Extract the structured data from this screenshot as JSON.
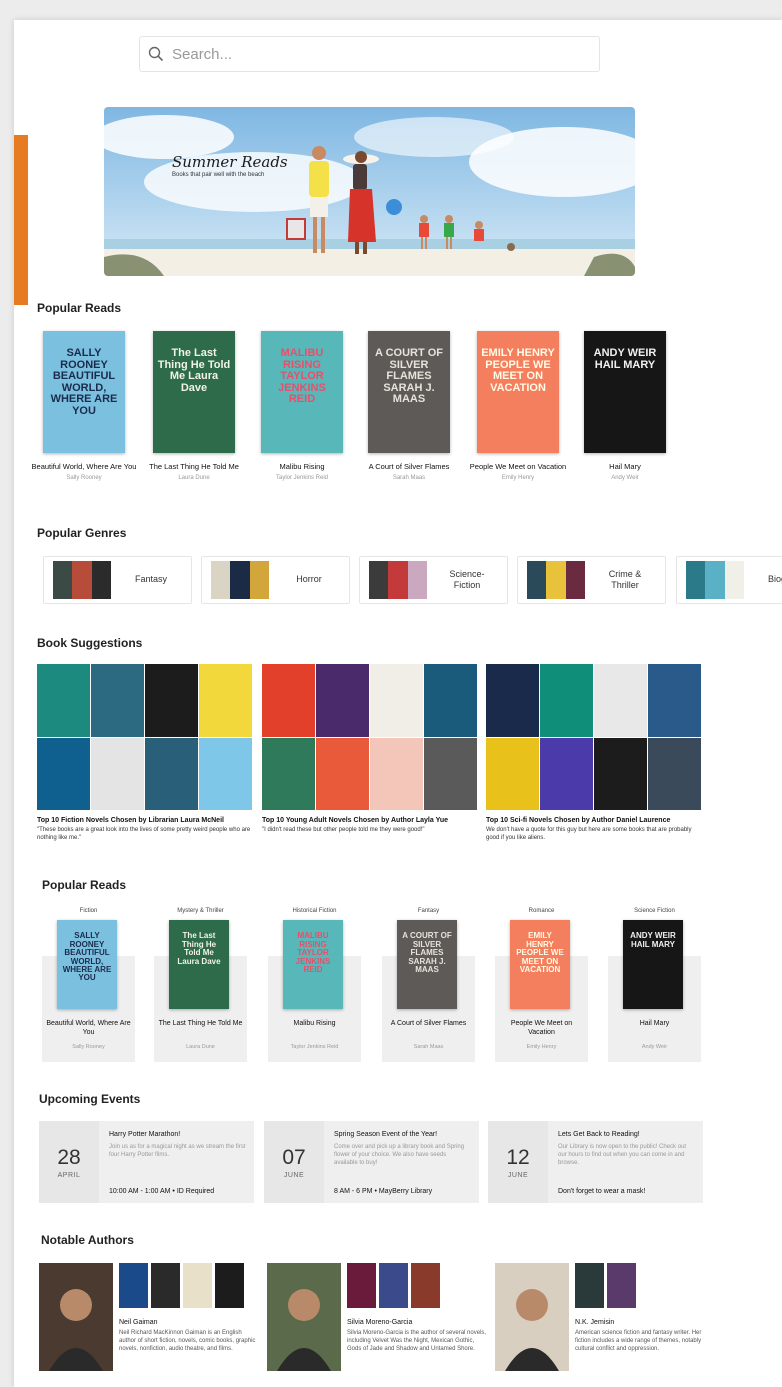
{
  "search": {
    "placeholder": "Search..."
  },
  "hero": {
    "title": "Summer Reads",
    "subtitle": "Books that pair well with the beach"
  },
  "sections": {
    "popular_reads": "Popular Reads",
    "popular_genres": "Popular Genres",
    "book_suggestions": "Book Suggestions",
    "popular_reads_2": "Popular Reads",
    "upcoming_events": "Upcoming Events",
    "notable_authors": "Notable Authors"
  },
  "books": [
    {
      "title": "Beautiful World, Where Are You",
      "author": "Sally Rooney",
      "cover_text": "SALLY ROONEY BEAUTIFUL WORLD, WHERE ARE YOU",
      "bg": "#7cc0e0",
      "fg": "#1a2c4c"
    },
    {
      "title": "The Last Thing He Told Me",
      "author": "Laura Dune",
      "cover_text": "The Last Thing He Told Me Laura Dave",
      "bg": "#2e6b4a",
      "fg": "#f2f2e8"
    },
    {
      "title": "Malibu Rising",
      "author": "Taylor Jenkins Reid",
      "cover_text": "MALIBU RISING TAYLOR JENKINS REID",
      "bg": "#58b8b9",
      "fg": "#e84f6a"
    },
    {
      "title": "A Court of Silver Flames",
      "author": "Sarah Maas",
      "cover_text": "A COURT OF SILVER FLAMES SARAH J. MAAS",
      "bg": "#5e5a58",
      "fg": "#e8e2da"
    },
    {
      "title": "People We Meet on Vacation",
      "author": "Emily Henry",
      "cover_text": "EMILY HENRY PEOPLE WE MEET ON VACATION",
      "bg": "#f47f5e",
      "fg": "#fffbe6"
    },
    {
      "title": "Hail Mary",
      "author": "Andy Weir",
      "cover_text": "ANDY WEIR HAIL MARY",
      "bg": "#161616",
      "fg": "#f0f0f0"
    }
  ],
  "genres": [
    {
      "label": "Fantasy",
      "colors": [
        "#3c4a45",
        "#b84c3a",
        "#2b2b2b"
      ]
    },
    {
      "label": "Horror",
      "colors": [
        "#d9d4c4",
        "#1c2b45",
        "#d2a63a"
      ]
    },
    {
      "label": "Science-\nFiction",
      "colors": [
        "#3b3b3b",
        "#c43a3a",
        "#c9a8c0"
      ]
    },
    {
      "label": "Crime &\nThriller",
      "colors": [
        "#2a4a5a",
        "#e8c23a",
        "#6a2a40"
      ]
    },
    {
      "label": "Biog",
      "colors": [
        "#2a7a8a",
        "#5ab0c4",
        "#f0efe8"
      ]
    }
  ],
  "suggestions": [
    {
      "title": "Top 10 Fiction Novels Chosen by Librarian Laura McNeil",
      "quote": "\"These books are a great look into the lives of some pretty weird people who are nothing like me.\"",
      "colors": [
        "#1d8a80",
        "#2b6a80",
        "#1c1c1c",
        "#f2d83a",
        "#0f5f8f",
        "#e4e4e4",
        "#2a5f7a",
        "#7fc7e8"
      ]
    },
    {
      "title": "Top 10 Young Adult Novels Chosen by Author Layla Yue",
      "quote": "\"I didn't read these but other people told me they were good!\"",
      "colors": [
        "#e2402a",
        "#4a2a6a",
        "#f0eee6",
        "#1a5a7a",
        "#2e7a5a",
        "#e85a3a",
        "#f4c6ba",
        "#5a5a5a"
      ]
    },
    {
      "title": "Top 10 Sci-fi Novels Chosen by Author Daniel Laurence",
      "quote": "We don't have a quote for this guy but here are some books that are probably good if you like aliens.",
      "colors": [
        "#1a2a4a",
        "#0f8f7a",
        "#e8e8e8",
        "#2a5a8a",
        "#e8c21a",
        "#4a3aaa",
        "#1c1c1c",
        "#3a4a5a"
      ]
    }
  ],
  "popular_reads_2": [
    {
      "genre": "Fiction",
      "book": 0
    },
    {
      "genre": "Mystery & Thriller",
      "book": 1
    },
    {
      "genre": "Historical Fiction",
      "book": 2
    },
    {
      "genre": "Fantasy",
      "book": 3
    },
    {
      "genre": "Romance",
      "book": 4
    },
    {
      "genre": "Science Fiction",
      "book": 5
    }
  ],
  "events": [
    {
      "day": "28",
      "month": "APRIL",
      "title": "Harry Potter Marathon!",
      "desc": "Join us as for a magical night as we stream the first four Harry Potter films.",
      "meta": "10:00 AM - 1:00 AM • ID Required"
    },
    {
      "day": "07",
      "month": "JUNE",
      "title": "Spring Season Event of the Year!",
      "desc": "Come over and pick up a library book and Spring flower of your choice. We also have seeds available to buy!",
      "meta": "8 AM - 6 PM • MayBerry Library"
    },
    {
      "day": "12",
      "month": "JUNE",
      "title": "Lets Get Back to Reading!",
      "desc": "Our Library is now open to the public! Check out our hours to find out when you can come in and browse.",
      "meta": "Don't forget to wear a mask!"
    }
  ],
  "authors": [
    {
      "name": "Neil Gaiman",
      "bio": "Neil Richard MacKinnon Gaiman is an English author of short fiction, novels, comic books, graphic novels, nonfiction, audio theatre, and films.",
      "photo": "#4a3a30",
      "books": [
        "#1a4a8a",
        "#2a2a2a",
        "#e8e0c8",
        "#1c1c1c"
      ]
    },
    {
      "name": "Silvia Moreno-Garcia",
      "bio": "Silvia Moreno-Garcia is the author of several novels, including Velvet Was the Night, Mexican Gothic, Gods of Jade and Shadow and Untamed Shore.",
      "photo": "#5a6a4a",
      "books": [
        "#6a1a3a",
        "#3a4a8a",
        "#8a3a2a"
      ]
    },
    {
      "name": "N.K. Jemisin",
      "bio": "American science fiction and fantasy writer. Her fiction includes a wide range of themes, notably cultural conflict and oppression.",
      "photo": "#d8cfc0",
      "books": [
        "#2a3a3a",
        "#5a3a6a"
      ]
    }
  ]
}
